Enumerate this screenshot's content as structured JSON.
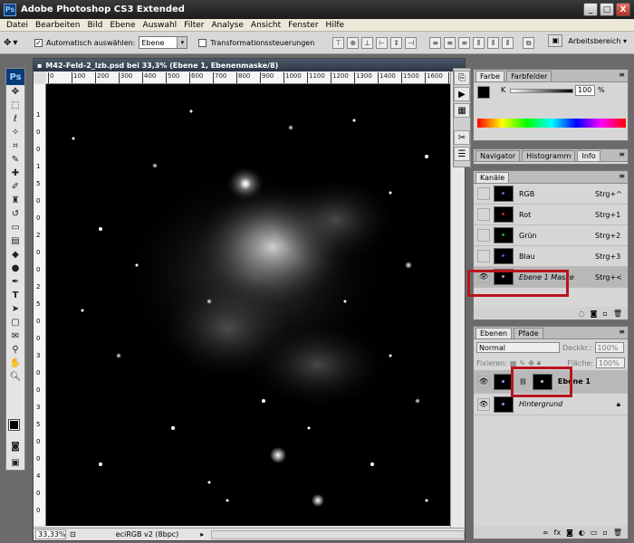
{
  "window": {
    "title": "Adobe Photoshop CS3 Extended",
    "min": "_",
    "max": "□",
    "close": "X"
  },
  "menu": [
    "Datei",
    "Bearbeiten",
    "Bild",
    "Ebene",
    "Auswahl",
    "Filter",
    "Analyse",
    "Ansicht",
    "Fenster",
    "Hilfe"
  ],
  "options": {
    "auto_select_label": "Automatisch auswählen:",
    "auto_select_value": "Ebene",
    "transform_label": "Transformationssteuerungen",
    "workspace_label": "Arbeitsbereich ▾"
  },
  "document": {
    "title": "M42-Feld-2_lzb.psd bei 33,3% (Ebene 1, Ebenenmaske/8)",
    "ruler_labels": [
      "0",
      "100",
      "200",
      "300",
      "400",
      "500",
      "600",
      "700",
      "800",
      "900",
      "1000",
      "1100",
      "1200",
      "1300",
      "1400",
      "1500",
      "1600",
      "1700"
    ],
    "ruler_v_labels": [
      "1",
      "0",
      "0",
      "1",
      "5",
      "0",
      "0",
      "2",
      "0",
      "0",
      "2",
      "5",
      "0",
      "0",
      "3",
      "0",
      "0",
      "3",
      "5",
      "0",
      "0",
      "4",
      "0",
      "0"
    ],
    "zoom": "33,33%",
    "profile": "eciRGB v2 (8bpc)"
  },
  "color_panel": {
    "tabs": [
      "Farbe",
      "Farbfelder"
    ],
    "channel": "K",
    "value": "100",
    "unit": "%"
  },
  "nav_panel": {
    "tabs": [
      "Navigator",
      "Histogramm",
      "Info"
    ]
  },
  "channels_panel": {
    "tab": "Kanäle",
    "rows": [
      {
        "name": "RGB",
        "shortcut": "Strg+^",
        "color": "#5566cc"
      },
      {
        "name": "Rot",
        "shortcut": "Strg+1",
        "color": "#cc2222"
      },
      {
        "name": "Grün",
        "shortcut": "Strg+2",
        "color": "#22aa33"
      },
      {
        "name": "Blau",
        "shortcut": "Strg+3",
        "color": "#3355ee"
      },
      {
        "name": "Ebene 1 Maske",
        "shortcut": "Strg+<",
        "color": "#aaaaaa"
      }
    ]
  },
  "layers_panel": {
    "tabs": [
      "Ebenen",
      "Pfade"
    ],
    "blend_mode": "Normal",
    "opacity_label": "Deckkr.:",
    "opacity_value": "100%",
    "lock_label": "Fixieren:",
    "fill_label": "Fläche:",
    "fill_value": "100%",
    "layers": [
      {
        "name": "Ebene 1"
      },
      {
        "name": "Hintergrund"
      }
    ]
  },
  "accent": {
    "highlight": "#b8141c"
  }
}
